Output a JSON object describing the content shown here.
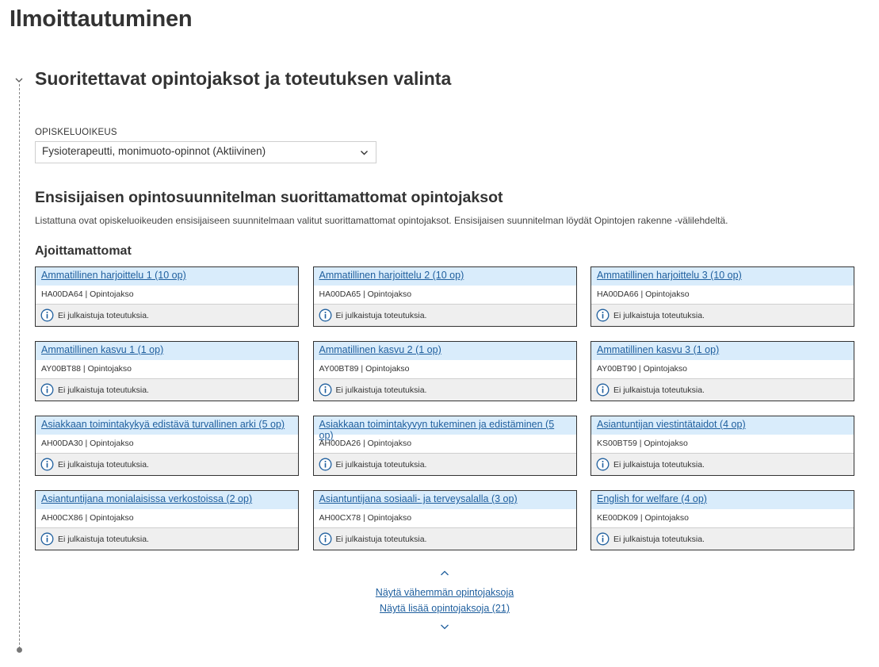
{
  "page": {
    "title": "Ilmoittautuminen"
  },
  "section": {
    "title": "Suoritettavat opintojaksot ja toteutuksen valinta",
    "field_label": "OPISKELUOIKEUS",
    "select_value": "Fysioterapeutti, monimuoto-opinnot (Aktiivinen)"
  },
  "subsection": {
    "title": "Ensisijaisen opintosuunnitelman suorittamattomat opintojaksot",
    "description": "Listattuna ovat opiskeluoikeuden ensisijaiseen suunnitelmaan valitut suorittamattomat opintojaksot. Ensisijaisen suunnitelman löydät Opintojen rakenne -välilehdeltä.",
    "group_title": "Ajoittamattomat"
  },
  "cards": [
    {
      "title": "Ammatillinen harjoittelu 1 (10 op)",
      "code": "HA00DA64 | Opintojakso",
      "info": "Ei julkaistuja toteutuksia."
    },
    {
      "title": "Ammatillinen harjoittelu 2 (10 op)",
      "code": "HA00DA65 | Opintojakso",
      "info": "Ei julkaistuja toteutuksia."
    },
    {
      "title": "Ammatillinen harjoittelu 3 (10 op)",
      "code": "HA00DA66 | Opintojakso",
      "info": "Ei julkaistuja toteutuksia."
    },
    {
      "title": "Ammatillinen kasvu 1 (1 op)",
      "code": "AY00BT88 | Opintojakso",
      "info": "Ei julkaistuja toteutuksia."
    },
    {
      "title": "Ammatillinen kasvu 2 (1 op)",
      "code": "AY00BT89 | Opintojakso",
      "info": "Ei julkaistuja toteutuksia."
    },
    {
      "title": "Ammatillinen kasvu 3 (1 op)",
      "code": "AY00BT90 | Opintojakso",
      "info": "Ei julkaistuja toteutuksia."
    },
    {
      "title": "Asiakkaan toimintakykyä edistävä turvallinen arki (5 op)",
      "code": "AH00DA30 | Opintojakso",
      "info": "Ei julkaistuja toteutuksia."
    },
    {
      "title": "Asiakkaan toimintakyvyn tukeminen ja edistäminen (5 op)",
      "code": "AH00DA26 | Opintojakso",
      "info": "Ei julkaistuja toteutuksia."
    },
    {
      "title": "Asiantuntijan viestintätaidot (4 op)",
      "code": "KS00BT59 | Opintojakso",
      "info": "Ei julkaistuja toteutuksia."
    },
    {
      "title": "Asiantuntijana monialaisissa verkostoissa (2 op)",
      "code": "AH00CX86 | Opintojakso",
      "info": "Ei julkaistuja toteutuksia."
    },
    {
      "title": "Asiantuntijana sosiaali- ja terveysalalla (3 op)",
      "code": "AH00CX78 | Opintojakso",
      "info": "Ei julkaistuja toteutuksia."
    },
    {
      "title": "English for welfare (4 op)",
      "code": "KE00DK09 | Opintojakso",
      "info": "Ei julkaistuja toteutuksia."
    }
  ],
  "pager": {
    "less_label": "Näytä vähemmän opintojaksoja",
    "more_label": "Näytä lisää opintojaksoja (21)"
  },
  "icons": {
    "collapse": "chevron-down-icon",
    "select": "chevron-down-icon",
    "info": "info-circle-icon",
    "pager_up": "chevron-up-icon",
    "pager_down": "chevron-down-icon"
  },
  "colors": {
    "link": "#1f5f9e",
    "card_header_bg": "#d9ecfb",
    "card_info_bg": "#efefef",
    "text": "#333333"
  }
}
